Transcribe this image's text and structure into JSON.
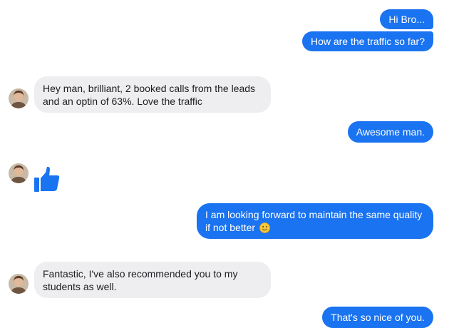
{
  "messages": {
    "m1": "Hi Bro...",
    "m2": "How are the traffic so far?",
    "m3": "Hey man, brilliant, 2 booked calls from the leads and an optin of 63%. Love the traffic",
    "m4": "Awesome man.",
    "m5": "I am looking forward to maintain the same quality if not better",
    "m6": "Fantastic, I've also recommended you to my students as well.",
    "m7": "That's so nice of you."
  },
  "icons": {
    "reaction": "thumbs-up-icon",
    "emoji": "smiling-face-icon",
    "avatar": "contact-avatar"
  },
  "colors": {
    "outgoing": "#1a73f0",
    "incoming": "#eeedf0",
    "thumbs_up": "#1a73f0"
  }
}
